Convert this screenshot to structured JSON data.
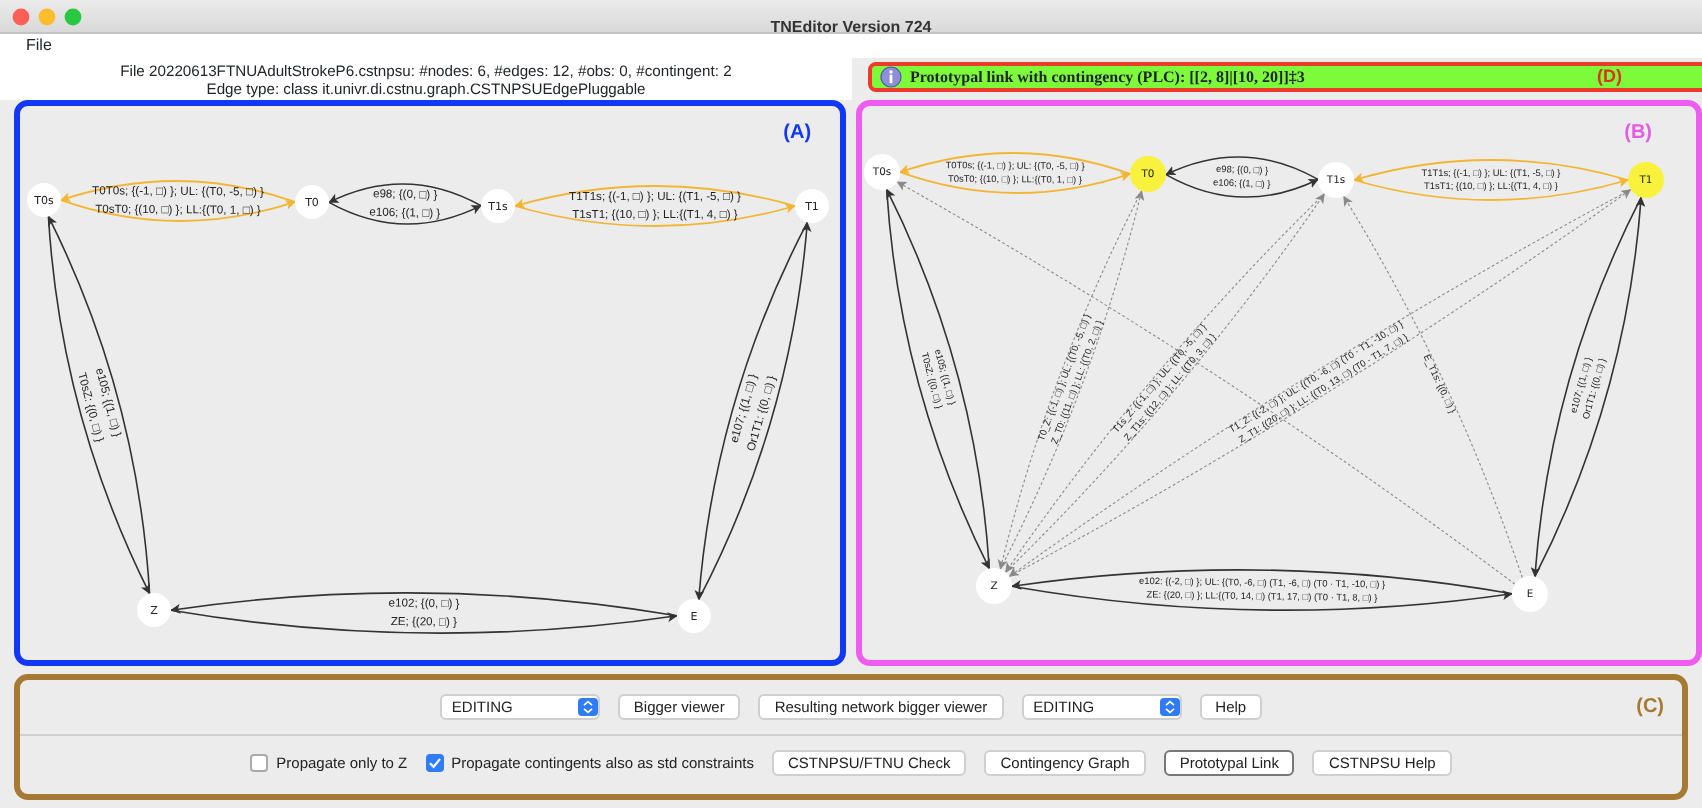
{
  "window": {
    "title": "TNEditor Version 724"
  },
  "menu": [
    "File"
  ],
  "file_info": [
    "File 20220613FTNUAdultStrokeP6.cstnpsu: #nodes: 6, #edges: 12, #obs: 0, #contingent: 2",
    "Edge type: class it.univr.di.cstnu.graph.CSTNPSUEdgePluggable"
  ],
  "plc_bar": {
    "text": "Prototypal link with contingency (PLC): [[2, 8]|[10, 20]]‡3",
    "tag": "(D)"
  },
  "input_graph": {
    "tag": "(A)",
    "nodes": [
      {
        "label": "T0s",
        "highlighted": false
      },
      {
        "label": "T0",
        "highlighted": false
      },
      {
        "label": "T1s",
        "highlighted": false
      },
      {
        "label": "T1",
        "highlighted": false
      },
      {
        "label": "Z",
        "highlighted": false
      },
      {
        "label": "E",
        "highlighted": false
      }
    ],
    "edges": [
      {
        "kind": "contingent",
        "label": "T0T0s; {(-1, □) }; UL: {(T0, -5, □) }"
      },
      {
        "kind": "contingent",
        "label": "T0sT0; {(10, □) }; LL:{(T0, 1, □) }"
      },
      {
        "kind": "ordinary",
        "label": "e98; {(0, □) }"
      },
      {
        "kind": "ordinary",
        "label": "e106; {(1, □) }"
      },
      {
        "kind": "contingent",
        "label": "T1T1s; {(-1, □) }; UL: {(T1, -5, □) }"
      },
      {
        "kind": "contingent",
        "label": "T1sT1; {(10, □) }; LL:{(T1, 4, □) }"
      },
      {
        "kind": "ordinary",
        "label": "e105; {(1, □) }"
      },
      {
        "kind": "ordinary",
        "label": "T0sZ: {(0, □) }"
      },
      {
        "kind": "ordinary",
        "label": "e107; {(1, □) }"
      },
      {
        "kind": "ordinary",
        "label": "Or1T1: {(0, □) }"
      },
      {
        "kind": "ordinary",
        "label": "e102; {(0, □) }"
      },
      {
        "kind": "ordinary",
        "label": "ZE; {(20, □) }"
      }
    ]
  },
  "result_graph": {
    "tag": "(B)",
    "nodes": [
      {
        "label": "T0s",
        "highlighted": false
      },
      {
        "label": "T0",
        "highlighted": true
      },
      {
        "label": "T1s",
        "highlighted": false
      },
      {
        "label": "T1",
        "highlighted": true
      },
      {
        "label": "Z",
        "highlighted": false
      },
      {
        "label": "E",
        "highlighted": false
      }
    ],
    "edges": [
      {
        "kind": "contingent",
        "label": "T0T0s; {(-1, □) }; UL: {(T0, -5, □) }"
      },
      {
        "kind": "contingent",
        "label": "T0sT0; {(10, □) }; LL:{(T0, 1, □) }"
      },
      {
        "kind": "ordinary",
        "label": "e98; {(0, □) }"
      },
      {
        "kind": "ordinary",
        "label": "e106; {(1, □) }"
      },
      {
        "kind": "contingent",
        "label": "T1T1s; {(-1, □) }; UL: {(T1, -5, □) }"
      },
      {
        "kind": "contingent",
        "label": "T1sT1; {(10, □) }; LL:{(T1, 4, □) }"
      },
      {
        "kind": "ordinary",
        "label": "e105; {(1, □) }"
      },
      {
        "kind": "ordinary",
        "label": "T0sZ: {(0, □) }"
      },
      {
        "kind": "ordinary",
        "label": "e107; {(1, □) }"
      },
      {
        "kind": "ordinary",
        "label": "Or1T1: {(0, □) }"
      },
      {
        "kind": "ordinary",
        "label": "e102: {(-2, □) }; UL: {(T0, -6, □) (T1, -6, □) (T0 · T1, -10, □) }"
      },
      {
        "kind": "ordinary",
        "label": "ZE: {(20, □) }; LL:{(T0, 14, □) (T1, 17, □) (T0 · T1, 8, □) }"
      },
      {
        "kind": "derived",
        "label": "T0_Z: {(-1, □) }; UL: {(T0, -5, □) }"
      },
      {
        "kind": "derived",
        "label": "Z_T0: {(11, □) }; LL: {(T0, 2, □) }"
      },
      {
        "kind": "derived",
        "label": "T1s_Z: {(-1, □) }; UL: {(T0, -5, □) }"
      },
      {
        "kind": "derived",
        "label": "Z_T1s: {(12, □) }; LL: {(T0, 3, □) }"
      },
      {
        "kind": "derived",
        "label": "T1_Z: {(-2, □) }; UL: {(T0, -6, □) (T0 · T1, -10, □) }"
      },
      {
        "kind": "derived",
        "label": "Z_T1: {(20, □) }; LL: {(T0, 13, □) (T0 · T1, 7, □) }"
      },
      {
        "kind": "derived"
      },
      {
        "kind": "derived",
        "label": "E_T1s: {(0, □) }"
      }
    ]
  },
  "controls": {
    "tag": "(C)",
    "row1": [
      {
        "kind": "dropdown",
        "label": "EDITING"
      },
      {
        "kind": "button",
        "label": "Bigger viewer",
        "selected": false
      },
      {
        "kind": "button",
        "label": "Resulting network bigger viewer",
        "selected": false
      },
      {
        "kind": "dropdown",
        "label": "EDITING"
      },
      {
        "kind": "button",
        "label": "Help",
        "selected": false
      }
    ],
    "row2": [
      {
        "kind": "checkbox",
        "label": "Propagate only to Z",
        "checked": false
      },
      {
        "kind": "checkbox",
        "label": "Propagate contingents also as std constraints",
        "checked": true
      },
      {
        "kind": "button",
        "label": "CSTNPSU/FTNU Check",
        "selected": false
      },
      {
        "kind": "button",
        "label": "Contingency Graph",
        "selected": false
      },
      {
        "kind": "button",
        "label": "Prototypal Link",
        "selected": true
      },
      {
        "kind": "button",
        "label": "CSTNPSU Help",
        "selected": false
      }
    ]
  }
}
